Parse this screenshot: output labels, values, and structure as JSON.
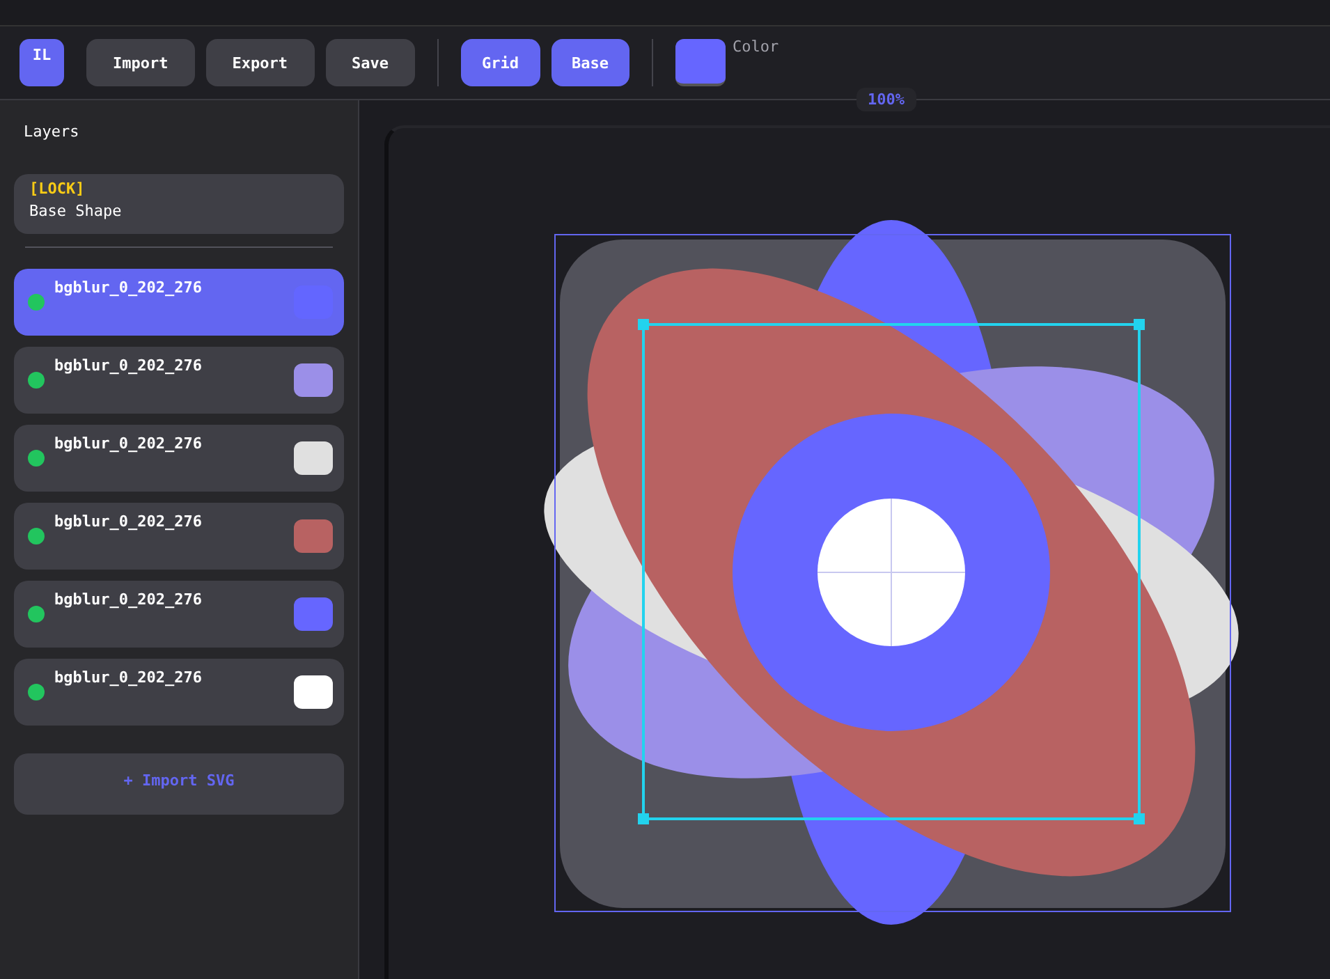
{
  "toolbar": {
    "logo": "IL",
    "file_buttons": [
      "Import",
      "Export",
      "Save"
    ],
    "toggles": [
      {
        "label": "Grid",
        "on": true
      },
      {
        "label": "Base",
        "on": true
      }
    ],
    "color": {
      "label": "Color",
      "color": "#6666ff"
    }
  },
  "sidebar": {
    "title": "Layers",
    "base_layer": {
      "badge": "[LOCK]",
      "name": "Base Shape"
    },
    "layers": [
      {
        "name": "bgblur_0_202_276",
        "visible": true,
        "selected": true,
        "color": "#6366ff"
      },
      {
        "name": "bgblur_0_202_276",
        "visible": true,
        "selected": false,
        "color": "#9b8fe8"
      },
      {
        "name": "bgblur_0_202_276",
        "visible": true,
        "selected": false,
        "color": "#e0e0e0"
      },
      {
        "name": "bgblur_0_202_276",
        "visible": true,
        "selected": false,
        "color": "#b86262"
      },
      {
        "name": "bgblur_0_202_276",
        "visible": true,
        "selected": false,
        "color": "#6666ff"
      },
      {
        "name": "bgblur_0_202_276",
        "visible": true,
        "selected": false,
        "color": "#ffffff"
      }
    ],
    "import_button": "+ Import SVG"
  },
  "canvas": {
    "zoom": "100%"
  }
}
